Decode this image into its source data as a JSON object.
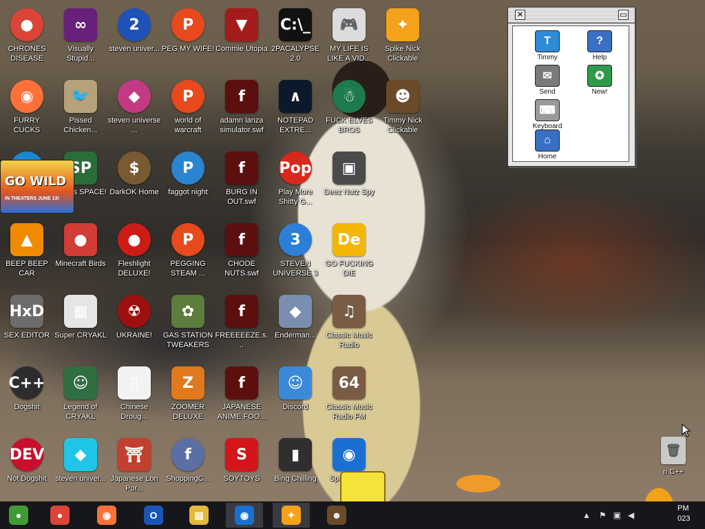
{
  "desktop_icons": [
    {
      "label": "CHRONES DISEASE",
      "glyph": "●",
      "color": "#db4437",
      "round": true
    },
    {
      "label": "FURRY CUCKS",
      "glyph": "◉",
      "color": "#ff7139",
      "round": true
    },
    {
      "label": "",
      "glyph": "",
      "color": "#1a88d2",
      "round": true
    },
    {
      "label": "BEEP BEEP CAR",
      "glyph": "▲",
      "color": "#f08a00",
      "round": false
    },
    {
      "label": "SEX EDITOR",
      "glyph": "HxD",
      "color": "#6c6c6c",
      "round": false
    },
    {
      "label": "Dogshit",
      "glyph": "C++",
      "color": "#2d2d2d",
      "round": true
    },
    {
      "label": "Not Dogshit",
      "glyph": "DEV",
      "color": "#c8102e",
      "round": true
    },
    {
      "label": "Visually Stupid...",
      "glyph": "∞",
      "color": "#68217a",
      "round": false
    },
    {
      "label": "Pissed Chicken...",
      "glyph": "🐦",
      "color": "#b5a27a",
      "round": false
    },
    {
      "label": "Avians SPACE!",
      "glyph": "SP",
      "color": "#2a6d3a",
      "round": false
    },
    {
      "label": "Minecraft Birds",
      "glyph": "●",
      "color": "#d13c36",
      "round": false
    },
    {
      "label": "Super CRYAKL",
      "glyph": "▦",
      "color": "#e5e5e5",
      "round": false
    },
    {
      "label": "Legend of CRYAKL",
      "glyph": "☺",
      "color": "#2f6e41",
      "round": false
    },
    {
      "label": "steven univer...",
      "glyph": "◆",
      "color": "#1fc6e8",
      "round": false
    },
    {
      "label": "steven univer...",
      "glyph": "2",
      "color": "#1f52b8",
      "round": true
    },
    {
      "label": "steven universe ...",
      "glyph": "◆",
      "color": "#c23a83",
      "round": true
    },
    {
      "label": "DarkOK Home",
      "glyph": "$",
      "color": "#7a5a32",
      "round": true
    },
    {
      "label": "Fleshlight DELUXE!",
      "glyph": "●",
      "color": "#cc1c16",
      "round": true
    },
    {
      "label": "UKRAINE!",
      "glyph": "☢",
      "color": "#9c1010",
      "round": true
    },
    {
      "label": "Chinese Droug...",
      "glyph": "▯",
      "color": "#f2f2f2",
      "round": false
    },
    {
      "label": "Japanese Lon Por...",
      "glyph": "⛩",
      "color": "#c2402f",
      "round": false
    },
    {
      "label": "PEG MY WIFE!",
      "glyph": "P",
      "color": "#e84a1d",
      "round": true
    },
    {
      "label": "world of warcraft",
      "glyph": "P",
      "color": "#e84a1d",
      "round": true
    },
    {
      "label": "faggot night",
      "glyph": "P",
      "color": "#2a85d0",
      "round": true
    },
    {
      "label": "PEGGING STEAM ...",
      "glyph": "P",
      "color": "#e84a1d",
      "round": true
    },
    {
      "label": "GAS STATION TWEAKERS",
      "glyph": "✿",
      "color": "#5d7d3c",
      "round": false
    },
    {
      "label": "ZOOMER DELUXE",
      "glyph": "Z",
      "color": "#e07a1c",
      "round": false
    },
    {
      "label": "ShoppingC...",
      "glyph": "f",
      "color": "#5b6fa6",
      "round": true
    },
    {
      "label": "Commie Utopia",
      "glyph": "▼",
      "color": "#a41b1b",
      "round": false
    },
    {
      "label": "adamn lanza simulator.swf",
      "glyph": "f",
      "color": "#5d0f0f",
      "round": false
    },
    {
      "label": "BURG IN OUT.swf",
      "glyph": "f",
      "color": "#5d0f0f",
      "round": false
    },
    {
      "label": "CHODE NUTS.swf",
      "glyph": "f",
      "color": "#5d0f0f",
      "round": false
    },
    {
      "label": "FREEEEEZE.s...",
      "glyph": "f",
      "color": "#5d0f0f",
      "round": false
    },
    {
      "label": "JAPANESE ANIME FOO...",
      "glyph": "f",
      "color": "#5d0f0f",
      "round": false
    },
    {
      "label": "SOYTOYS",
      "glyph": "S",
      "color": "#d4161b",
      "round": false
    },
    {
      "label": "2PACALYPSE 2.0",
      "glyph": "C:\\_",
      "color": "#111111",
      "round": false
    },
    {
      "label": "NOTEPAD EXTRE...",
      "glyph": "∧",
      "color": "#0a1a2a",
      "round": false
    },
    {
      "label": "Play More Shitty G...",
      "glyph": "Pop",
      "color": "#d8281d",
      "round": true
    },
    {
      "label": "STEVEN UNIVERSE 3",
      "glyph": "3",
      "color": "#2c7ed6",
      "round": true
    },
    {
      "label": "Enderman...",
      "glyph": "◆",
      "color": "#7a8fb0",
      "round": false
    },
    {
      "label": "Discord",
      "glyph": "☺",
      "color": "#3b8ad9",
      "round": false
    },
    {
      "label": "Bing Chilling",
      "glyph": "▮",
      "color": "#2f2f2f",
      "round": false
    },
    {
      "label": "MY LIFE IS LIKE A VID...",
      "glyph": "🎮",
      "color": "#dcdcdc",
      "round": false
    },
    {
      "label": "FUCK ELVES BROS",
      "glyph": "☃",
      "color": "#1d7a4c",
      "round": true
    },
    {
      "label": "Deez Nutz Spy",
      "glyph": "▣",
      "color": "#4a4a4a",
      "round": false
    },
    {
      "label": "GO FUCKING DIE",
      "glyph": "De",
      "color": "#f2b705",
      "round": false
    },
    {
      "label": "Classic Music Radio",
      "glyph": "♫",
      "color": "#7a5b44",
      "round": false
    },
    {
      "label": "Classic Music Radio FM",
      "glyph": "64",
      "color": "#7a5b44",
      "round": false
    },
    {
      "label": "Spo... Nic...",
      "glyph": "◉",
      "color": "#1a6fd2",
      "round": false
    },
    {
      "label": "Spike Nick Clickable",
      "glyph": "✦",
      "color": "#f4a21a",
      "round": false
    },
    {
      "label": "Timmy Nick Clickable",
      "glyph": "☻",
      "color": "#6b4a2a",
      "round": false
    }
  ],
  "mac_window": {
    "items": [
      {
        "label": "Timmy",
        "glyph": "T",
        "color": "#2e8bd6"
      },
      {
        "label": "Help",
        "glyph": "?",
        "color": "#3a6fc4"
      },
      {
        "label": "Send",
        "glyph": "✉",
        "color": "#7a7a7a"
      },
      {
        "label": "New!",
        "glyph": "✪",
        "color": "#2f9a4a"
      },
      {
        "label": "Keyboard",
        "glyph": "⌨",
        "color": "#9a9a9a"
      },
      {
        "label": "Home",
        "glyph": "⌂",
        "color": "#3a6fc4"
      }
    ]
  },
  "recycle_bin_label": "n C++",
  "taskbar": {
    "apps": [
      {
        "name": "chrome-alt",
        "glyph": "●",
        "color": "#3f9c35",
        "active": false
      },
      {
        "name": "chrome",
        "glyph": "●",
        "color": "#db4437",
        "active": false
      },
      {
        "name": "firefox",
        "glyph": "◉",
        "color": "#ff7139",
        "active": false
      },
      {
        "name": "obama",
        "glyph": "O",
        "color": "#1a56b8",
        "active": false
      },
      {
        "name": "file-explorer",
        "glyph": "▤",
        "color": "#e6b83a",
        "active": false
      },
      {
        "name": "spongebob-game",
        "glyph": "◉",
        "color": "#1a6fd2",
        "active": true
      },
      {
        "name": "spike-nick",
        "glyph": "✦",
        "color": "#f4a21a",
        "active": true
      },
      {
        "name": "timmy-nick",
        "glyph": "☻",
        "color": "#6b4a2a",
        "active": false
      }
    ],
    "clock_time": "PM",
    "clock_date": "023"
  },
  "go_wild_banner": {
    "title": "GO WILD",
    "sub": "IN THEATERS JUNE 13!"
  }
}
